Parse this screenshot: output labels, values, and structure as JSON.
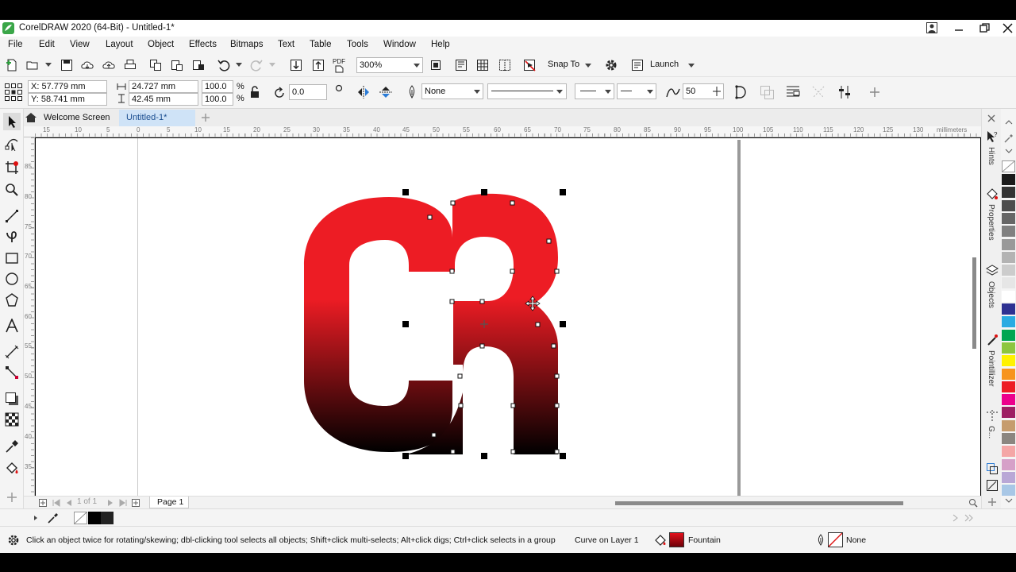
{
  "app": {
    "title": "CorelDRAW 2020 (64-Bit) - Untitled-1*"
  },
  "menu": [
    "File",
    "Edit",
    "View",
    "Layout",
    "Object",
    "Effects",
    "Bitmaps",
    "Text",
    "Table",
    "Tools",
    "Window",
    "Help"
  ],
  "toolbar": {
    "zoom": "300%",
    "snap_to": "Snap To",
    "launch": "Launch",
    "pdf_label": "PDF"
  },
  "properties": {
    "x": "X: 57.779 mm",
    "y": "Y: 58.741 mm",
    "width": "24.727 mm",
    "height": "42.45 mm",
    "scale_w": "100.0",
    "scale_h": "100.0",
    "percent": "%",
    "rotation": "0.0",
    "outline_width": "None",
    "smoothing": "50"
  },
  "tabs": {
    "welcome": "Welcome Screen",
    "document": "Untitled-1*"
  },
  "ruler": {
    "unit": "millimeters",
    "h_ticks": [
      "15",
      "10",
      "5",
      "0",
      "5",
      "10",
      "15",
      "20",
      "25",
      "30",
      "35",
      "40",
      "45",
      "50",
      "55",
      "60",
      "65",
      "70",
      "75",
      "80",
      "85",
      "90",
      "95",
      "100",
      "105",
      "110",
      "115",
      "120",
      "125",
      "130"
    ],
    "v_ticks": [
      "85",
      "80",
      "75",
      "70",
      "65",
      "60",
      "55",
      "50",
      "45",
      "40",
      "35"
    ]
  },
  "docnav": {
    "page_of": "1 of 1",
    "page_tab": "Page 1"
  },
  "dockers": [
    "Hints",
    "Properties",
    "Objects",
    "Pointillizer",
    "G..."
  ],
  "palette_colors": [
    "#ffffff",
    "#1a1a1a",
    "#333333",
    "#4d4d4d",
    "#666666",
    "#808080",
    "#999999",
    "#b3b3b3",
    "#cccccc",
    "#e6e6e6",
    "#ffffff",
    "#2e3192",
    "#29abe2",
    "#00a651",
    "#8dc63f",
    "#fff200",
    "#f7941d",
    "#ed1c24",
    "#ec008c",
    "#9e1f63",
    "#c69c6d",
    "#8b8680",
    "#f4a6a6",
    "#d6a0c8",
    "#b9a7d6",
    "#a8c7e6"
  ],
  "status": {
    "hint": "Click an object twice for rotating/skewing; dbl-clicking tool selects all objects; Shift+click multi-selects; Alt+click digs; Ctrl+click selects in a group",
    "object_info": "Curve on Layer 1",
    "fill": "Fountain",
    "outline": "None"
  },
  "artwork": {
    "gradient_top": "#ed1c24",
    "gradient_bottom": "#000000"
  }
}
